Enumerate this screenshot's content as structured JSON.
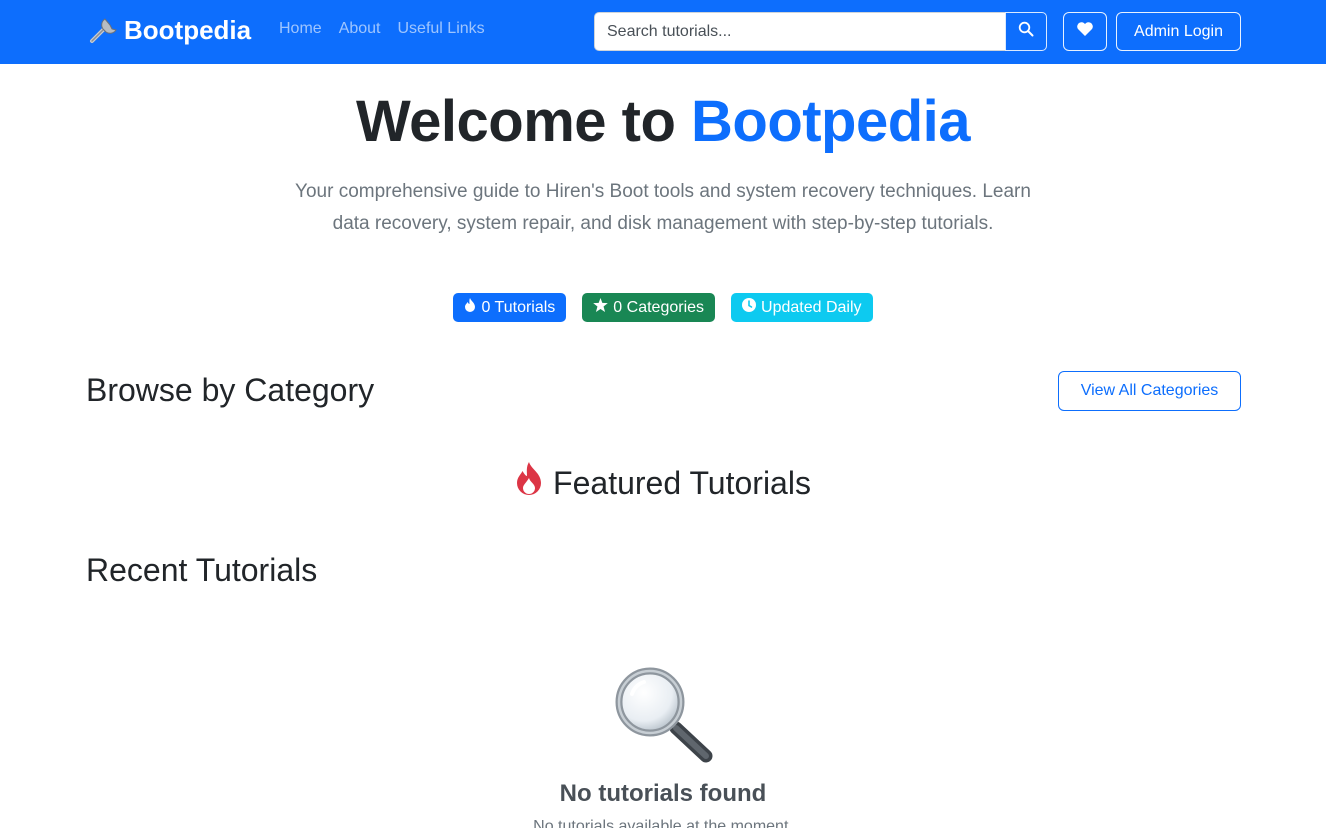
{
  "navbar": {
    "brand": "Bootpedia",
    "brand_icon": "wrench-icon",
    "links": [
      "Home",
      "About",
      "Useful Links"
    ],
    "search_placeholder": "Search tutorials...",
    "search_icon": "search-icon",
    "favorites_icon": "heart-icon",
    "admin_label": "Admin Login",
    "background_color": "#0d6efd"
  },
  "hero": {
    "title_prefix": "Welcome to",
    "title_accent": "Bootpedia",
    "accent_color": "#0d6efd",
    "subtitle": "Your comprehensive guide to Hiren's Boot tools and system recovery techniques. Learn data recovery, system repair, and disk management with step-by-step tutorials.",
    "badges": [
      {
        "icon": "fire-icon",
        "label": "0 Tutorials",
        "color": "#0d6efd"
      },
      {
        "icon": "star-icon",
        "label": "0 Categories",
        "color": "#198754"
      },
      {
        "icon": "clock-icon",
        "label": "Updated Daily",
        "color": "#0dcaf0"
      }
    ]
  },
  "categories": {
    "heading": "Browse by Category",
    "view_all_label": "View All Categories"
  },
  "featured": {
    "icon": "fire-icon",
    "heading": "Featured Tutorials"
  },
  "recent": {
    "heading": "Recent Tutorials",
    "empty_icon": "magnifying-glass-icon",
    "empty_title": "No tutorials found",
    "empty_text": "No tutorials available at the moment."
  }
}
